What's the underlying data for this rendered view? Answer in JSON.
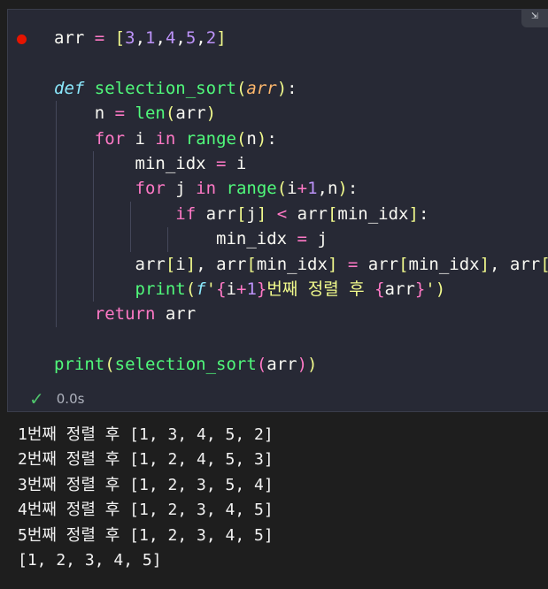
{
  "cell": {
    "icons": {
      "corner": "collapse-icon",
      "breakpoint": "breakpoint-dot-icon",
      "status": "checkmark-icon"
    },
    "code_lines": [
      "arr = [3,1,4,5,2]",
      "",
      "def selection_sort(arr):",
      "    n = len(arr)",
      "    for i in range(n):",
      "        min_idx = i",
      "        for j in range(i+1,n):",
      "            if arr[j] < arr[min_idx]:",
      "                min_idx = j",
      "        arr[i], arr[min_idx] = arr[min_idx], arr[i]",
      "        print(f'{i+1}번째 정렬 후 {arr}')",
      "    return arr",
      "",
      "print(selection_sort(arr))"
    ],
    "exec_time": "0.0s"
  },
  "output": {
    "lines": [
      "1번째 정렬 후 [1, 3, 4, 5, 2]",
      "2번째 정렬 후 [1, 2, 4, 5, 3]",
      "3번째 정렬 후 [1, 2, 3, 5, 4]",
      "4번째 정렬 후 [1, 2, 3, 4, 5]",
      "5번째 정렬 후 [1, 2, 3, 4, 5]",
      "[1, 2, 3, 4, 5]"
    ]
  },
  "colors": {
    "background": "#1e1e1e",
    "cell_background": "#272935",
    "keyword": "#ff79c6",
    "function": "#50fa7b",
    "number": "#bd93f9",
    "string": "#f1fa8c",
    "breakpoint": "#e51400",
    "success": "#4ec36b"
  }
}
